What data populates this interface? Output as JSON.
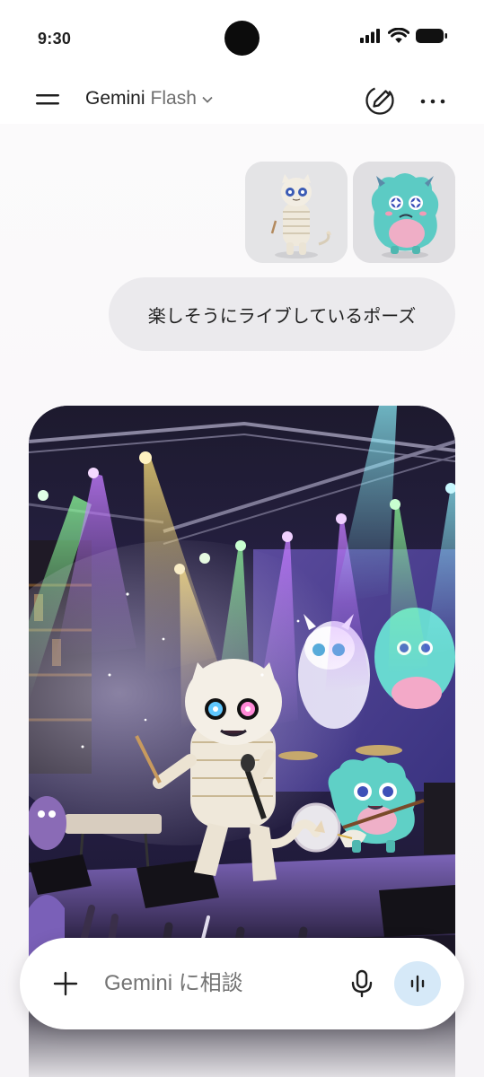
{
  "status_bar": {
    "time": "9:30"
  },
  "header": {
    "model_name": "Gemini",
    "model_variant": "Flash"
  },
  "chat": {
    "user_message": "楽しそうにライブしているポーズ"
  },
  "input": {
    "placeholder": "Gemini に相談"
  },
  "icons": {
    "menu": "menu-icon",
    "chevron": "chevron-down-icon",
    "edit": "edit-icon",
    "more": "more-icon",
    "add": "plus-icon",
    "mic": "mic-icon",
    "live": "live-waveform-icon"
  },
  "colors": {
    "live_button_bg": "#d6e9f8",
    "bubble_bg": "#ebeaed",
    "page_bg": "#f8f6f8"
  }
}
